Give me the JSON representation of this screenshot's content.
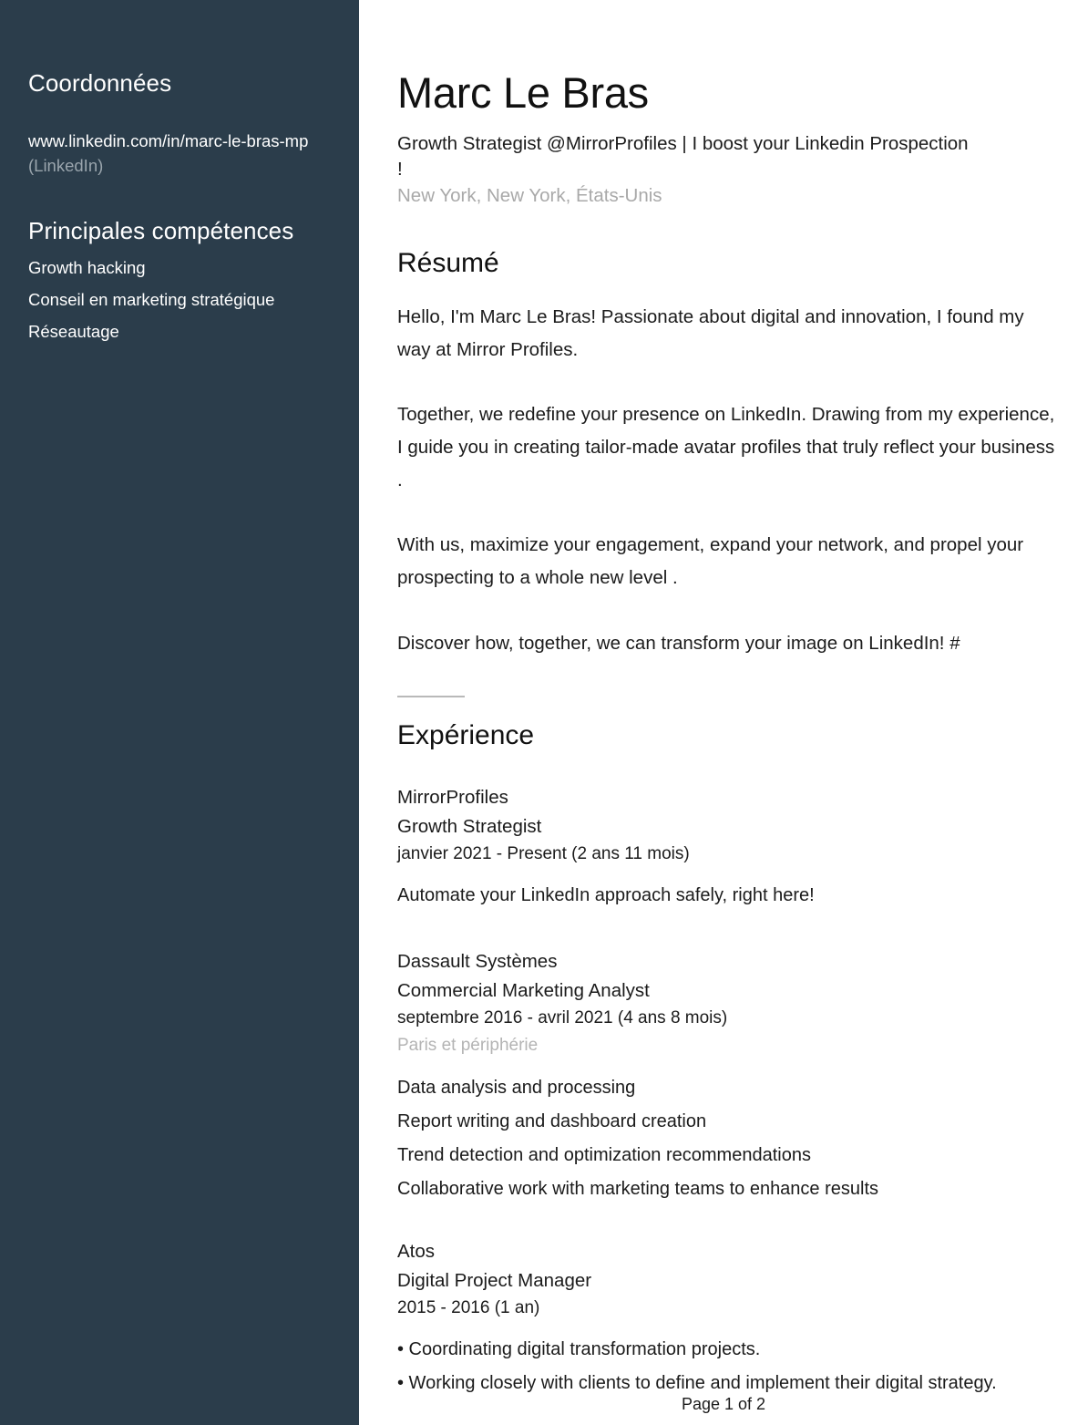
{
  "sidebar": {
    "contact_heading": "Coordonnées",
    "linkedin_url": "www.linkedin.com/in/marc-le-bras-mp",
    "linkedin_label": "(LinkedIn)",
    "skills_heading": "Principales compétences",
    "skills": [
      "Growth hacking",
      "Conseil en marketing stratégique",
      "Réseautage"
    ]
  },
  "header": {
    "name": "Marc Le Bras",
    "headline": "Growth Strategist @MirrorProfiles | I boost your Linkedin Prospection !",
    "location": "New York, New York, États-Unis"
  },
  "summary": {
    "title": "Résumé",
    "paragraphs": [
      "Hello, I'm Marc Le Bras! Passionate about digital and innovation, I found my way at Mirror Profiles.",
      "Together, we redefine your presence on LinkedIn. Drawing from my experience, I guide you in creating tailor-made avatar profiles that truly reflect your business .",
      "With us, maximize your engagement, expand your network, and propel your prospecting to a whole new level .",
      "Discover how, together, we can transform your image on LinkedIn! #"
    ]
  },
  "experience": {
    "title": "Expérience",
    "jobs": [
      {
        "company": "MirrorProfiles",
        "role": "Growth Strategist",
        "dates": "janvier 2021 - Present (2 ans 11 mois)",
        "location": "",
        "bullets": [
          "Automate your LinkedIn approach safely, right here!"
        ]
      },
      {
        "company": "Dassault Systèmes",
        "role": "Commercial Marketing Analyst",
        "dates": "septembre 2016 - avril 2021 (4 ans 8 mois)",
        "location": "Paris et périphérie",
        "bullets": [
          "Data analysis and processing",
          "Report writing and dashboard creation",
          "Trend detection and optimization recommendations",
          "Collaborative work with marketing teams to enhance results"
        ]
      },
      {
        "company": "Atos",
        "role": "Digital Project Manager",
        "dates": "2015 - 2016 (1 an)",
        "location": "",
        "bullets": [
          "• Coordinating digital transformation projects.",
          "• Working closely with clients to define and implement their digital strategy."
        ]
      }
    ]
  },
  "footer": {
    "page_label": "Page 1 of 2"
  },
  "colors": {
    "sidebar_bg": "#2b3d4b",
    "page_bg": "#ffffff",
    "text": "#1b1b1b",
    "muted": "#a9a9a9",
    "sidebar_muted": "#9aa5ad"
  }
}
